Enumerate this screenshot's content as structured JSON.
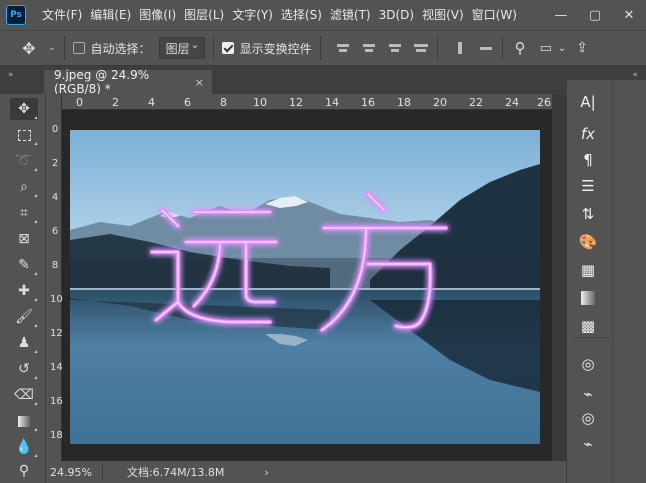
{
  "app": {
    "logo_text": "Ps"
  },
  "menu": [
    "文件(F)",
    "编辑(E)",
    "图像(I)",
    "图层(L)",
    "文字(Y)",
    "选择(S)",
    "滤镜(T)",
    "3D(D)",
    "视图(V)",
    "窗口(W)"
  ],
  "window_buttons": {
    "minimize": "—",
    "maximize": "▢",
    "close": "✕"
  },
  "options": {
    "auto_select_label": "自动选择：",
    "auto_select_checked": false,
    "layer_select_value": "图层",
    "show_transform_label": "显示变换控件",
    "show_transform_checked": true
  },
  "document": {
    "tab_title": "9.jpeg @ 24.9%(RGB/8) *",
    "close": "×"
  },
  "ruler": {
    "top_ticks": [
      "0",
      "2",
      "4",
      "6",
      "8",
      "10",
      "12",
      "14",
      "16",
      "18",
      "20",
      "22",
      "24",
      "26"
    ],
    "left_ticks": [
      "0",
      "2",
      "4",
      "6",
      "8",
      "10",
      "12",
      "14",
      "16",
      "18"
    ]
  },
  "image_text": "远方",
  "status": {
    "zoom": "24.95%",
    "doc_info": "文档:6.74M/13.8M",
    "arrow": "›"
  },
  "colors": {
    "glow": "#d67bff",
    "ui_bg": "#535353",
    "canvas_bg": "#282828"
  }
}
